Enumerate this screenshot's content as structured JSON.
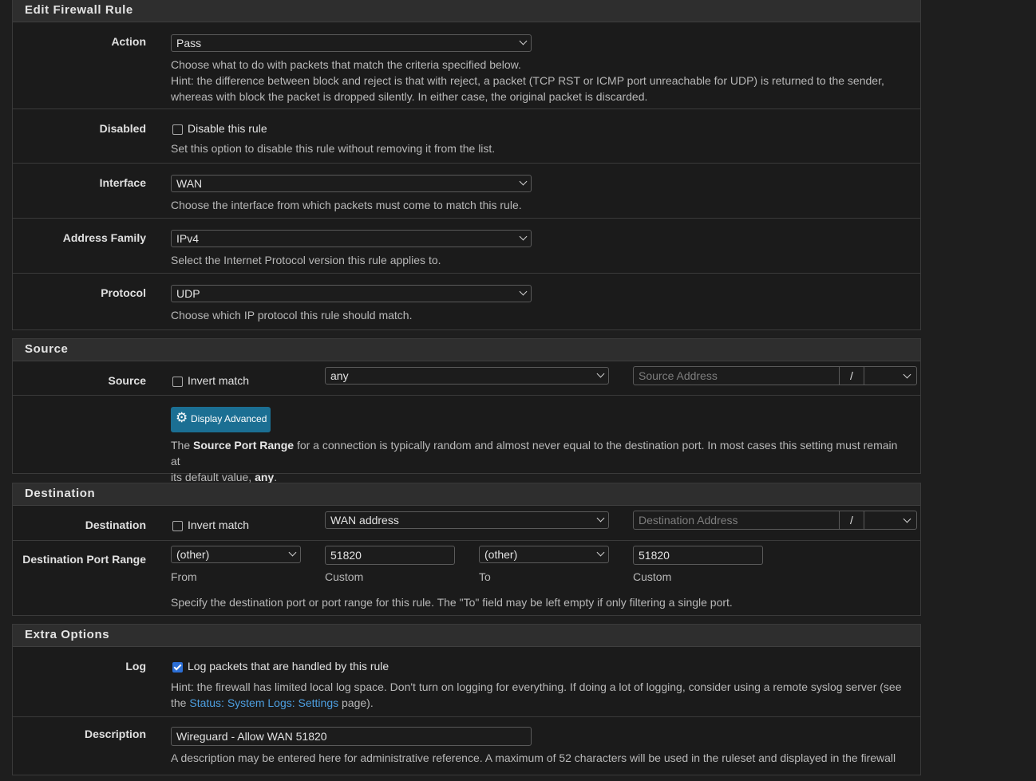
{
  "edit_rule": {
    "title": "Edit Firewall Rule",
    "action": {
      "label": "Action",
      "value": "Pass",
      "help1": "Choose what to do with packets that match the criteria specified below.",
      "help2": "Hint: the difference between block and reject is that with reject, a packet (TCP RST or ICMP port unreachable for UDP) is returned to the sender,",
      "help3": "whereas with block the packet is dropped silently. In either case, the original packet is discarded."
    },
    "disabled": {
      "label": "Disabled",
      "checkbox_label": "Disable this rule",
      "checked": false,
      "help": "Set this option to disable this rule without removing it from the list."
    },
    "interface": {
      "label": "Interface",
      "value": "WAN",
      "help": "Choose the interface from which packets must come to match this rule."
    },
    "address_family": {
      "label": "Address Family",
      "value": "IPv4",
      "help": "Select the Internet Protocol version this rule applies to."
    },
    "protocol": {
      "label": "Protocol",
      "value": "UDP",
      "help": "Choose which IP protocol this rule should match."
    }
  },
  "source": {
    "title": "Source",
    "label": "Source",
    "invert_label": "Invert match",
    "invert_checked": false,
    "type_value": "any",
    "address_placeholder": "Source Address",
    "slash": "/",
    "advanced_button": "Display Advanced",
    "help_pre": "The",
    "help_bold1": "Source Port Range",
    "help_mid": "for a connection is typically random and almost never equal to the destination port. In most cases this setting must remain at",
    "help_line2_pre": "its default value,",
    "help_bold2": "any",
    "help_end": "."
  },
  "destination": {
    "title": "Destination",
    "label": "Destination",
    "invert_label": "Invert match",
    "invert_checked": false,
    "type_value": "WAN address",
    "address_placeholder": "Destination Address",
    "slash": "/",
    "port_range_label": "Destination Port Range",
    "from_select": "(other)",
    "from_custom": "51820",
    "to_select": "(other)",
    "to_custom": "51820",
    "from_label": "From",
    "custom_label": "Custom",
    "to_label": "To",
    "help": "Specify the destination port or port range for this rule. The \"To\" field may be left empty if only filtering a single port."
  },
  "extra": {
    "title": "Extra Options",
    "log_label": "Log",
    "log_checkbox_label": "Log packets that are handled by this rule",
    "log_checked": true,
    "log_help1": "Hint: the firewall has limited local log space. Don't turn on logging for everything. If doing a lot of logging, consider using a remote syslog server (see",
    "log_help2_pre": "the",
    "log_link": "Status: System Logs: Settings",
    "log_help2_post": "page).",
    "description_label": "Description",
    "description_value": "Wireguard - Allow WAN 51820",
    "description_help": "A description may be entered here for administrative reference. A maximum of 52 characters will be used in the ruleset and displayed in the firewall"
  },
  "colors": {
    "background": "#1e1e1e",
    "panel_heading": "#2e2e2e",
    "button": "#1b6f93",
    "link": "#4d9fe0",
    "checkbox_checked": "#2c6fd6"
  }
}
